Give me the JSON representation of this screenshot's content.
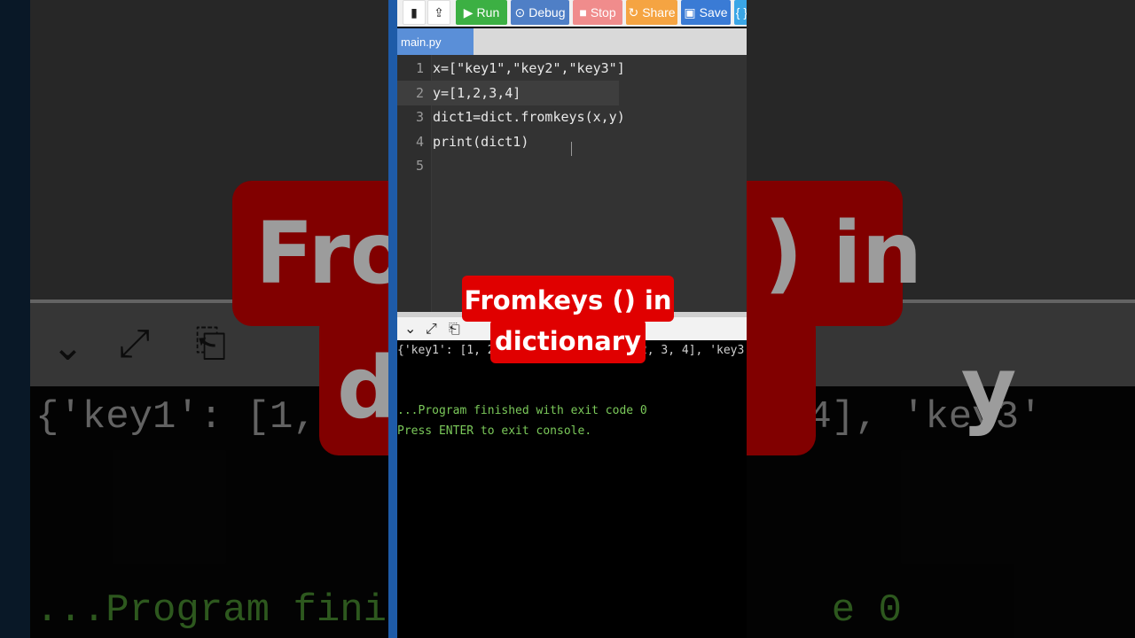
{
  "toolbar": {
    "run_label": "Run",
    "debug_label": "Debug",
    "stop_label": "Stop",
    "share_label": "Share",
    "save_label": "Save",
    "beautify_label": "{ } B"
  },
  "tabs": [
    {
      "label": "main.py"
    }
  ],
  "editor": {
    "line_numbers": [
      "1",
      "2",
      "3",
      "4",
      "5"
    ],
    "lines": [
      "x=[\"key1\",\"key2\",\"key3\"]",
      "y=[1,2,3,4]",
      "dict1=dict.fromkeys(x,y)",
      "print(dict1)",
      ""
    ]
  },
  "console": {
    "output": "{'key1': [1, 2, 3, 4], 'key2': [1, 2, 3, 4], 'key3'",
    "finished": "...Program finished with exit code 0",
    "press": "Press ENTER to exit console."
  },
  "caption": {
    "line1": "Fromkeys () in",
    "line2": "dictionary"
  },
  "background": {
    "banner_line1": "From         ) in",
    "banner_line2": "d                   y",
    "console_output": "{'key1': [1, 2              , 3, 4], 'key3'",
    "console_finished": "...Program finish                 e 0"
  },
  "colors": {
    "run": "#3cb043",
    "debug": "#4f7fc6",
    "stop": "#f08c8c",
    "share": "#f5a442",
    "save": "#3a7bd5",
    "caption_bg": "#e00000",
    "console_success": "#7bc95a"
  }
}
